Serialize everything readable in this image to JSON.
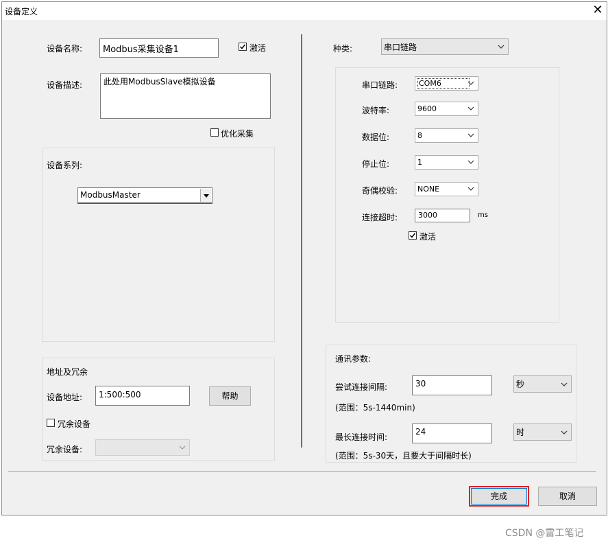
{
  "window": {
    "title": "设备定义"
  },
  "left": {
    "device_name_label": "设备名称:",
    "device_name_value": "Modbus采集设备1",
    "activate_label": "激活",
    "device_desc_label": "设备描述:",
    "device_desc_value": "此处用ModbusSlave模拟设备",
    "optimize_label": "优化采集",
    "series_label": "设备系列:",
    "series_value": "ModbusMaster",
    "addr_group_label": "地址及冗余",
    "addr_label": "设备地址:",
    "addr_value": "1:500:500",
    "help_button": "帮助",
    "redundant_check_label": "冗余设备",
    "redundant_device_label": "冗余设备:",
    "redundant_device_value": ""
  },
  "right": {
    "kind_label": "种类:",
    "kind_value": "串口链路",
    "serial": {
      "port_label": "串口链路:",
      "port_value": "COM6",
      "baud_label": "波特率:",
      "baud_value": "9600",
      "databits_label": "数据位:",
      "databits_value": "8",
      "stopbits_label": "停止位:",
      "stopbits_value": "1",
      "parity_label": "奇偶校验:",
      "parity_value": "NONE",
      "timeout_label": "连接超时:",
      "timeout_value": "3000",
      "timeout_unit": "ms",
      "activate_label": "激活"
    },
    "comm": {
      "group_label": "通讯参数:",
      "retry_label": "尝试连接间隔:",
      "retry_value": "30",
      "retry_unit": "秒",
      "retry_range": "(范围：5s-1440min)",
      "maxconn_label": "最长连接时间:",
      "maxconn_value": "24",
      "maxconn_unit": "时",
      "maxconn_range": "(范围：5s-30天，且要大于间隔时长)"
    }
  },
  "footer": {
    "finish_button": "完成",
    "cancel_button": "取消"
  },
  "watermark": "CSDN @雷工笔记",
  "colors": {
    "highlight": "#e02020",
    "focus_blue": "#0078d7"
  }
}
